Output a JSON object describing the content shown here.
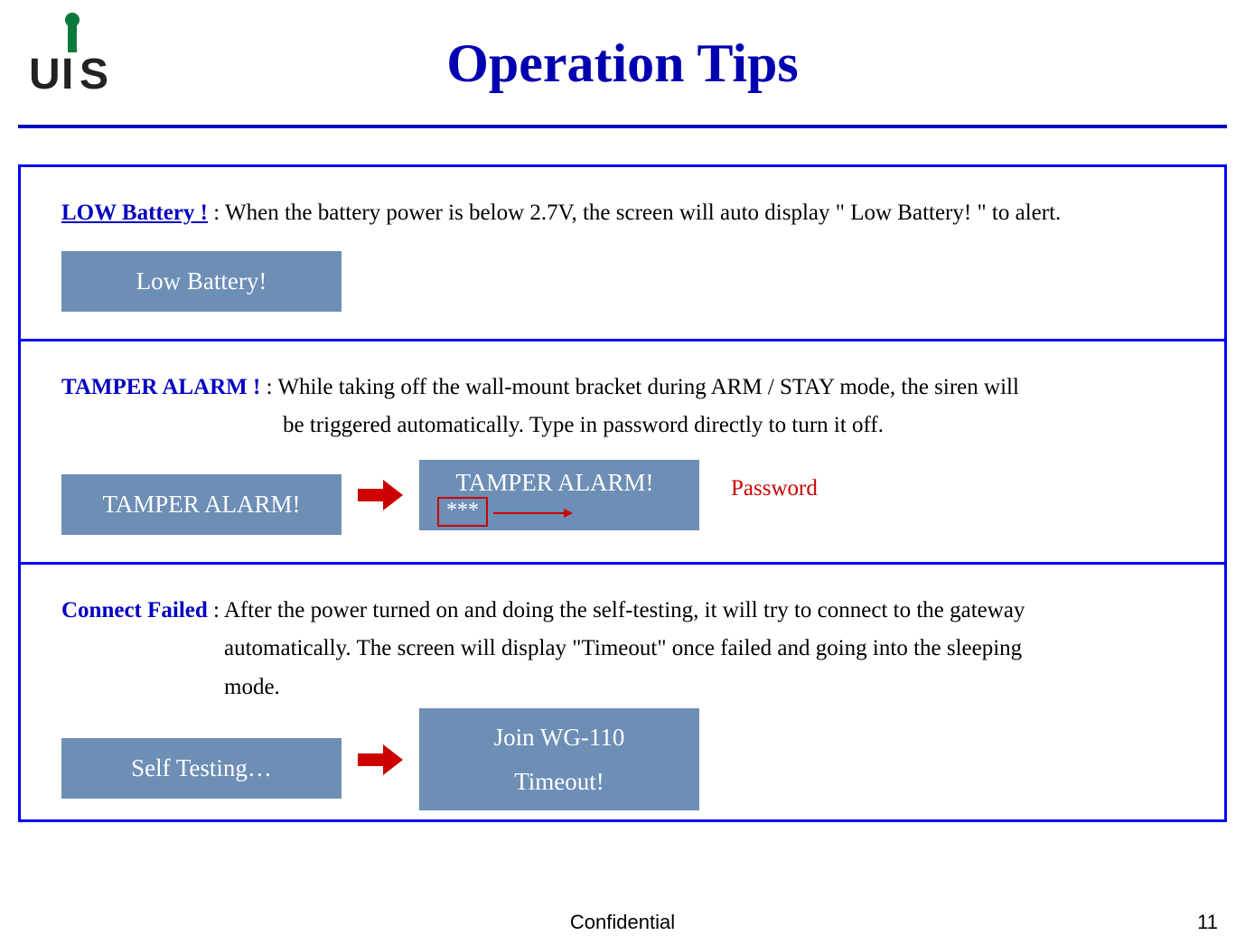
{
  "logo": {
    "text": "UIS",
    "letters": [
      "U",
      "I",
      "S"
    ]
  },
  "title": "Operation Tips",
  "sections": {
    "low_battery": {
      "label": "LOW Battery !",
      "desc": " : When the battery power is below 2.7V, the screen will auto display \" Low Battery! \" to alert.",
      "lcd": "Low Battery!"
    },
    "tamper": {
      "label": "TAMPER ALARM !",
      "desc_line1": " : While taking off the wall-mount bracket during ARM / STAY mode, the siren will",
      "desc_line2": "be triggered automatically. Type in password directly to turn it off.",
      "lcd1": "TAMPER ALARM!",
      "lcd2": "TAMPER ALARM!",
      "stars": "***",
      "annotation": "Password"
    },
    "connect": {
      "label": "Connect Failed",
      "desc_line1": " : After the power turned on and doing the self-testing, it will try to connect to the gateway",
      "desc_line2": "automatically. The screen will display \"Timeout\" once failed and going into the sleeping",
      "desc_line3": "mode.",
      "lcd1": "Self  Testing…",
      "lcd2_line1": "Join WG-110",
      "lcd2_line2": "Timeout!"
    }
  },
  "footer": {
    "confidential": "Confidential",
    "page": "11"
  }
}
